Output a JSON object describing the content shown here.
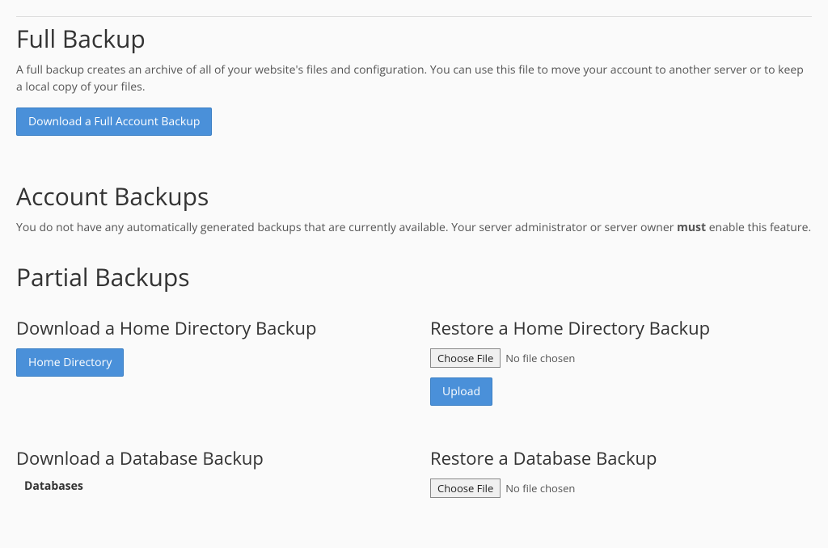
{
  "full_backup": {
    "heading": "Full Backup",
    "description": "A full backup creates an archive of all of your website's files and configuration. You can use this file to move your account to another server or to keep a local copy of your files.",
    "button_label": "Download a Full Account Backup"
  },
  "account_backups": {
    "heading": "Account Backups",
    "description_before": "You do not have any automatically generated backups that are currently available. Your server administrator or server owner ",
    "description_bold": "must",
    "description_after": " enable this feature."
  },
  "partial_backups": {
    "heading": "Partial Backups",
    "download_home": {
      "heading": "Download a Home Directory Backup",
      "button_label": "Home Directory"
    },
    "restore_home": {
      "heading": "Restore a Home Directory Backup",
      "choose_file_label": "Choose File",
      "file_status": "No file chosen",
      "upload_label": "Upload"
    },
    "download_db": {
      "heading": "Download a Database Backup",
      "databases_label": "Databases"
    },
    "restore_db": {
      "heading": "Restore a Database Backup",
      "choose_file_label": "Choose File",
      "file_status": "No file chosen"
    }
  }
}
